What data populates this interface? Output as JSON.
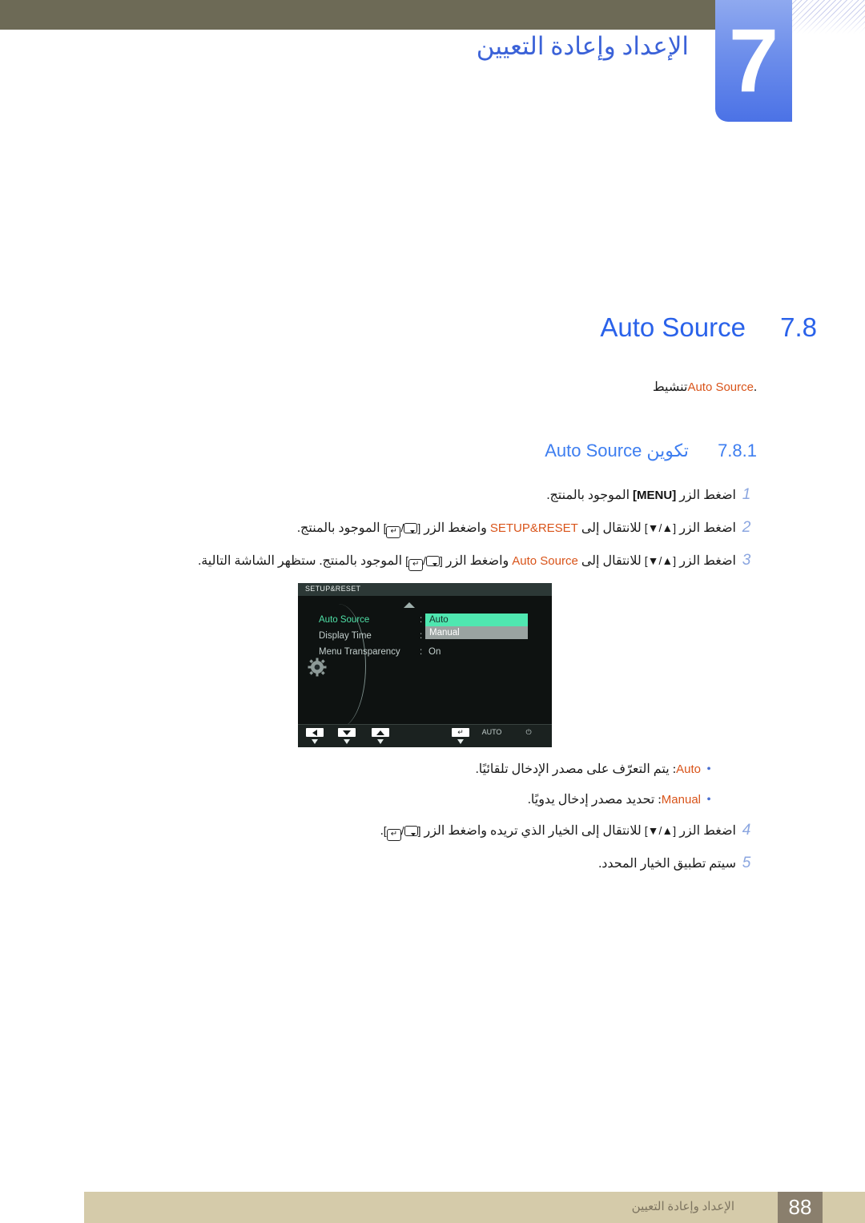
{
  "header": {
    "chapter_number": "7",
    "chapter_title": "الإعداد وإعادة التعيين"
  },
  "section": {
    "number": "7.8",
    "name": "Auto Source",
    "description_prefix": "تنشيط ",
    "description_keyword": "Auto Source",
    "description_suffix": "."
  },
  "subsection": {
    "number": "7.8.1",
    "name_prefix": "تكوين ",
    "name_keyword": "Auto Source"
  },
  "steps": [
    {
      "num": "1",
      "parts": [
        {
          "t": "اضغط الزر ",
          "style": "ar"
        },
        {
          "t": "[MENU]",
          "style": "bold"
        },
        {
          "t": " الموجود بالمنتج.",
          "style": "ar"
        }
      ]
    },
    {
      "num": "2",
      "parts": [
        {
          "t": "اضغط الزر ",
          "style": "ar"
        },
        {
          "t": "[▲/▼]",
          "style": "key"
        },
        {
          "t": " للانتقال إلى ",
          "style": "ar"
        },
        {
          "t": "SETUP&RESET",
          "style": "orange"
        },
        {
          "t": " واضغط الزر ",
          "style": "ar"
        },
        {
          "t": "[GLYPHS]",
          "style": "glyph"
        },
        {
          "t": " الموجود بالمنتج.",
          "style": "ar"
        }
      ]
    },
    {
      "num": "3",
      "parts": [
        {
          "t": "اضغط الزر ",
          "style": "ar"
        },
        {
          "t": "[▲/▼]",
          "style": "key"
        },
        {
          "t": " للانتقال إلى ",
          "style": "ar"
        },
        {
          "t": "Auto Source",
          "style": "orange"
        },
        {
          "t": " واضغط الزر ",
          "style": "ar"
        },
        {
          "t": "[GLYPHS]",
          "style": "glyph"
        },
        {
          "t": " الموجود بالمنتج. ستظهر الشاشة التالية.",
          "style": "ar"
        }
      ]
    },
    {
      "num": "4",
      "parts": [
        {
          "t": "اضغط الزر ",
          "style": "ar"
        },
        {
          "t": "[▲/▼]",
          "style": "key"
        },
        {
          "t": " للانتقال إلى الخيار الذي تريده واضغط الزر ",
          "style": "ar"
        },
        {
          "t": "[GLYPHS]",
          "style": "glyph"
        },
        {
          "t": ".",
          "style": "ar"
        }
      ]
    },
    {
      "num": "5",
      "parts": [
        {
          "t": "سيتم تطبيق الخيار المحدد.",
          "style": "ar"
        }
      ]
    }
  ],
  "step1": {
    "num": "1",
    "pre": "اضغط الزر ",
    "key": "[MENU]",
    "post": " الموجود بالمنتج."
  },
  "step2": {
    "num": "2",
    "pre": "اضغط الزر ",
    "arrows": "[▲/▼]",
    "mid": " للانتقال إلى ",
    "keyword": "SETUP&RESET",
    "mid2": " واضغط الزر ",
    "post": " الموجود بالمنتج."
  },
  "step3": {
    "num": "3",
    "pre": "اضغط الزر ",
    "arrows": "[▲/▼]",
    "mid": " للانتقال إلى ",
    "keyword": "Auto Source",
    "mid2": " واضغط الزر ",
    "post": " الموجود بالمنتج. ستظهر الشاشة التالية."
  },
  "step4": {
    "num": "4",
    "pre": "اضغط الزر ",
    "arrows": "[▲/▼]",
    "mid": " للانتقال إلى الخيار الذي تريده واضغط الزر ",
    "post": "."
  },
  "step5": {
    "num": "5",
    "text": "سيتم تطبيق الخيار المحدد."
  },
  "osd": {
    "title": "SETUP&RESET",
    "rows": [
      {
        "label": "Auto Source",
        "colon": ":",
        "value": ""
      },
      {
        "label": "Display Time",
        "colon": ":",
        "value": ""
      },
      {
        "label": "Menu Transparency",
        "colon": ":",
        "value": "On"
      }
    ],
    "options": [
      {
        "label": "Auto",
        "state": "selected"
      },
      {
        "label": "Manual",
        "state": "normal"
      }
    ],
    "buttons": [
      {
        "name": "left",
        "label": "◀"
      },
      {
        "name": "down",
        "label": "▼"
      },
      {
        "name": "up",
        "label": "▲"
      },
      {
        "name": "enter",
        "label": "↵"
      },
      {
        "name": "auto",
        "label": "AUTO"
      },
      {
        "name": "power",
        "label": "⏻"
      }
    ],
    "colors": {
      "highlight_selected": "#4fe7b0",
      "highlight_normal": "#9aa3a1",
      "active_label": "#4fe0a6",
      "background": "#0e1211",
      "titlebar": "#2c3836"
    }
  },
  "bullets": [
    {
      "keyword": "Auto",
      "text": ": يتم التعرّف على مصدر الإدخال تلقائيًا."
    },
    {
      "keyword": "Manual",
      "text": ": تحديد مصدر إدخال يدويًا."
    }
  ],
  "footer": {
    "page_number": "88",
    "text": "الإعداد وإعادة التعيين"
  },
  "colors": {
    "header_bar": "#6d6a56",
    "chapter_blue": "#5b82ea",
    "heading_blue": "#2a62ea",
    "accent_orange": "#d9541a",
    "footer_bar": "#d5cbaa",
    "footer_page_box": "#8a7f6d"
  }
}
